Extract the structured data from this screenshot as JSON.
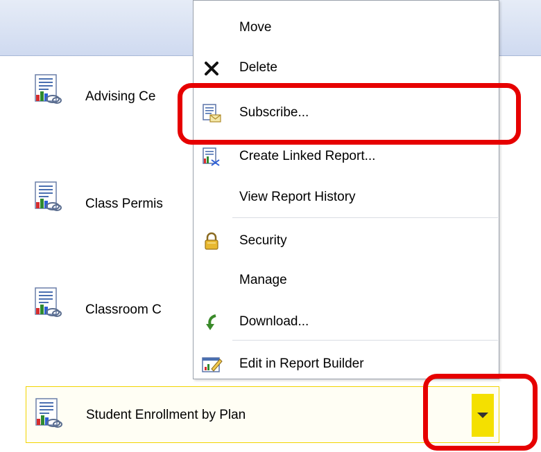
{
  "reports": [
    {
      "label": "Advising Ce"
    },
    {
      "label": "Class Permis"
    },
    {
      "label": "Classroom C"
    }
  ],
  "selected_report": {
    "label": "Student Enrollment by Plan"
  },
  "menu": {
    "move": "Move",
    "delete": "Delete",
    "subscribe": "Subscribe...",
    "create_linked": "Create Linked Report...",
    "history": "View Report History",
    "security": "Security",
    "manage": "Manage",
    "download": "Download...",
    "edit_builder": "Edit in Report Builder"
  },
  "colors": {
    "highlight": "#e60000",
    "dropdown_accent": "#f4e000"
  }
}
